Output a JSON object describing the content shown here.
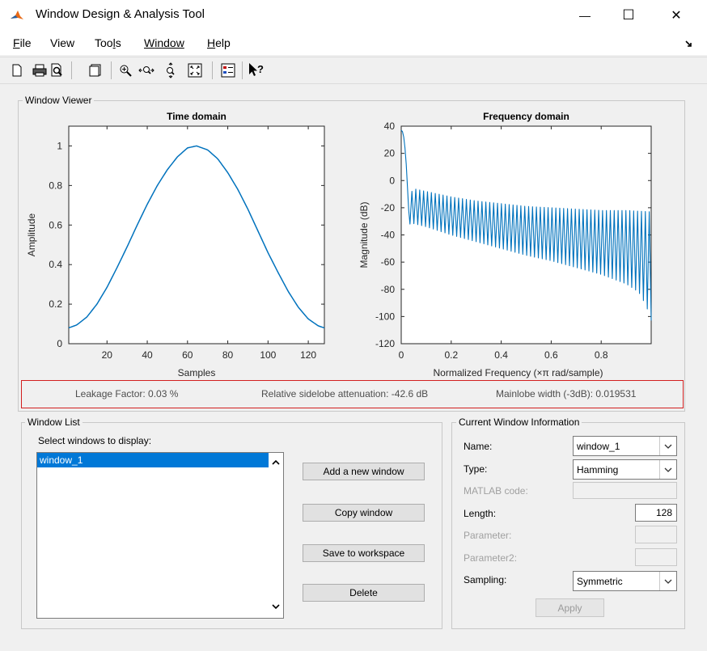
{
  "window": {
    "title": "Window Design & Analysis Tool",
    "minimize_glyph": "—",
    "maximize_glyph": "☐",
    "close_glyph": "✕"
  },
  "menu": {
    "items": [
      {
        "pre": "",
        "u": "F",
        "post": "ile"
      },
      {
        "pre": "Vi",
        "u": "e",
        "post": "w"
      },
      {
        "pre": "Too",
        "u": "l",
        "post": "s"
      },
      {
        "pre": "",
        "u": "W",
        "post": "indow"
      },
      {
        "pre": "",
        "u": "H",
        "post": "elp"
      }
    ]
  },
  "toolbar": {
    "icons": [
      "new-document-icon",
      "print-icon",
      "print-preview-icon",
      "new-figure-icon",
      "zoom-in-icon",
      "zoom-x-icon",
      "zoom-y-icon",
      "full-view-icon",
      "legend-icon",
      "whats-this-icon"
    ]
  },
  "viewer": {
    "group_title": "Window Viewer",
    "stats": {
      "leakage": "Leakage Factor: 0.03 %",
      "sidelobe": "Relative sidelobe attenuation: -42.6 dB",
      "mainlobe": "Mainlobe width (-3dB): 0.019531"
    }
  },
  "chart_data": [
    {
      "type": "line",
      "title": "Time domain",
      "xlabel": "Samples",
      "ylabel": "Amplitude",
      "xlim": [
        1,
        128
      ],
      "ylim": [
        0,
        1.1
      ],
      "xticks": [
        "20",
        "40",
        "60",
        "80",
        "100",
        "120"
      ],
      "yticks": [
        "0",
        "0.2",
        "0.4",
        "0.6",
        "0.8",
        "1"
      ],
      "series": [
        {
          "color": "#0072bd",
          "x": [
            1,
            5,
            10,
            15,
            20,
            25,
            30,
            35,
            40,
            45,
            50,
            55,
            60,
            64.5,
            70,
            75,
            80,
            85,
            90,
            95,
            100,
            105,
            110,
            115,
            120,
            125,
            128
          ],
          "y": [
            0.08,
            0.095,
            0.135,
            0.2,
            0.285,
            0.385,
            0.49,
            0.6,
            0.705,
            0.8,
            0.88,
            0.945,
            0.99,
            1.0,
            0.98,
            0.935,
            0.865,
            0.78,
            0.68,
            0.57,
            0.46,
            0.36,
            0.265,
            0.185,
            0.125,
            0.09,
            0.08
          ]
        }
      ],
      "grid": false
    },
    {
      "type": "line",
      "title": "Frequency domain",
      "xlabel": "Normalized Frequency  (×π rad/sample)",
      "ylabel": "Magnitude (dB)",
      "xlim": [
        0,
        1
      ],
      "ylim": [
        -120,
        40
      ],
      "xticks": [
        "0",
        "0.2",
        "0.4",
        "0.6",
        "0.8"
      ],
      "yticks": [
        "-120",
        "-100",
        "-80",
        "-60",
        "-40",
        "-20",
        "0",
        "20",
        "40"
      ],
      "mainlobe": {
        "x": [
          0,
          0.005,
          0.01,
          0.015,
          0.02,
          0.025,
          0.03,
          0.035
        ],
        "y": [
          37,
          36,
          32,
          24,
          12,
          -5,
          -22,
          -32
        ]
      },
      "sidelobe_peak": {
        "x": [
          0.035,
          0.05,
          0.1,
          0.2,
          0.3,
          0.4,
          0.5,
          0.6,
          0.7,
          0.8,
          0.9,
          1.0
        ],
        "y": [
          -10,
          -6,
          -8,
          -12,
          -15,
          -17,
          -19,
          -20,
          -21,
          -22,
          -22,
          -23
        ]
      },
      "sidelobe_floor": {
        "x": [
          0.035,
          0.1,
          0.2,
          0.3,
          0.4,
          0.5,
          0.6,
          0.7,
          0.8,
          0.9,
          0.95,
          0.98,
          1.0
        ],
        "y": [
          -31,
          -34,
          -40,
          -45,
          -50,
          -55,
          -59,
          -64,
          -69,
          -76,
          -82,
          -92,
          -103
        ]
      },
      "sidelobe_count": 62,
      "color": "#0072bd",
      "grid": false
    }
  ],
  "window_list": {
    "group_title": "Window List",
    "select_label": "Select windows to display:",
    "items": [
      "window_1"
    ],
    "buttons": {
      "add": "Add a new window",
      "copy": "Copy window",
      "save": "Save to workspace",
      "delete": "Delete"
    }
  },
  "info": {
    "group_title": "Current Window Information",
    "name_label": "Name:",
    "name_value": "window_1",
    "type_label": "Type:",
    "type_value": "Hamming",
    "matlab_label": "MATLAB code:",
    "length_label": "Length:",
    "length_value": "128",
    "parameter_label": "Parameter:",
    "parameter2_label": "Parameter2:",
    "sampling_label": "Sampling:",
    "sampling_value": "Symmetric",
    "apply_label": "Apply"
  }
}
